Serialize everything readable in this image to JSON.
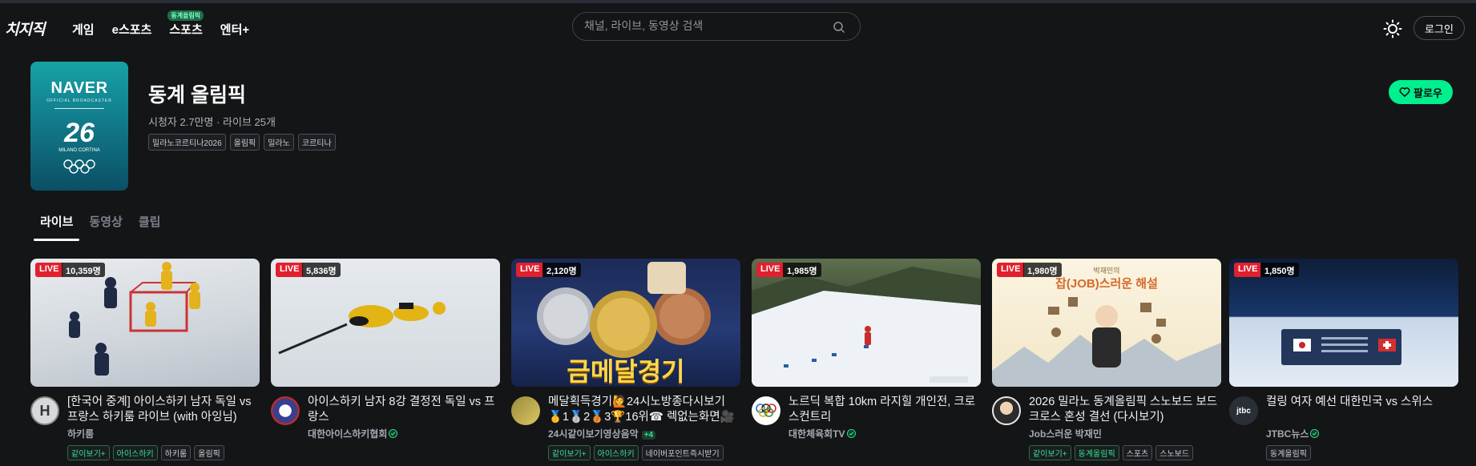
{
  "header": {
    "logo": "치지직",
    "nav": [
      {
        "label": "게임"
      },
      {
        "label": "e스포츠"
      },
      {
        "label": "스포츠",
        "badge": "동계올림픽"
      },
      {
        "label": "엔터+"
      }
    ],
    "search_placeholder": "채널, 라이브, 동영상 검색",
    "login_label": "로그인"
  },
  "channel": {
    "thumb_brand": "NAVER",
    "thumb_sub": "OFFICIAL BROADCASTER",
    "thumb_mark": "26",
    "thumb_event": "MILANO CORTINA",
    "name": "동계 올림픽",
    "stats": "시청자 2.7만명 · 라이브 25개",
    "tags": [
      "밀라노코르티나2026",
      "올림픽",
      "밀라노",
      "코르티나"
    ],
    "follow_label": "팔로우"
  },
  "tabs": [
    {
      "label": "라이브",
      "active": true
    },
    {
      "label": "동영상",
      "active": false
    },
    {
      "label": "클립",
      "active": false
    }
  ],
  "colors": {
    "accent": "#00f08f",
    "live": "#e0202e",
    "background": "#141517"
  },
  "cards": [
    {
      "live": "LIVE",
      "viewers": "10,359명",
      "title": "[한국어 중계] 아이스하키 남자 독일 vs 프랑스 하키룸 라이브 (with 아잉님)",
      "channel": "하키룸",
      "tags": [
        {
          "label": "같이보기+",
          "green": true
        },
        {
          "label": "아이스하키",
          "green": true
        },
        {
          "label": "하키룸",
          "green": false
        },
        {
          "label": "올림픽",
          "green": false
        }
      ]
    },
    {
      "live": "LIVE",
      "viewers": "5,836명",
      "title": "아이스하키 남자 8강 결정전 독일 vs 프랑스",
      "channel": "대한아이스하키협회",
      "tags": []
    },
    {
      "live": "LIVE",
      "viewers": "2,120명",
      "title": "메달획득경기🙋24시노방종다시보기🥇1🥈2🥉3🏆16위☎ 렉없는화면🎥 가...",
      "channel": "24시같이보기영상음악",
      "extra": "+4",
      "tags": [
        {
          "label": "같이보기+",
          "green": true
        },
        {
          "label": "아이스하키",
          "green": true
        },
        {
          "label": "네이버포인트즉시받기",
          "green": false
        }
      ]
    },
    {
      "live": "LIVE",
      "viewers": "1,985명",
      "title": "노르딕 복합 10km 라지힐 개인전, 크로스컨트리",
      "channel": "대한체육회TV",
      "tags": []
    },
    {
      "live": "LIVE",
      "viewers": "1,980명",
      "title": "2026 밀라노 동계올림픽 스노보드 보드크로스 혼성 결선 (다시보기)",
      "channel": "Job스러운 박재민",
      "tags": [
        {
          "label": "같이보기+",
          "green": true
        },
        {
          "label": "동계올림픽",
          "green": true
        },
        {
          "label": "스포츠",
          "green": false
        },
        {
          "label": "스노보드",
          "green": false
        }
      ]
    },
    {
      "live": "LIVE",
      "viewers": "1,850명",
      "title": "컬링 여자 예선 대한민국 vs 스위스",
      "channel": "JTBC뉴스",
      "tags": [
        {
          "label": "동계올림픽",
          "green": false
        }
      ]
    }
  ],
  "thumb_texts": {
    "c3_banner": "금메달경기",
    "c5_heading": "잡(JOB)스러운 해설",
    "c5_sub": "박재민의"
  }
}
